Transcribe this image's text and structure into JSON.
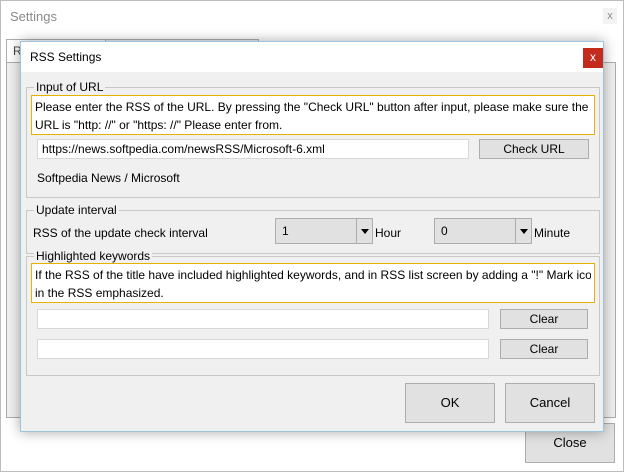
{
  "background": {
    "title": "Settings",
    "close_glyph": "x",
    "tab_a": "R",
    "tab_b": "",
    "close_button": "Close"
  },
  "dialog": {
    "title": "RSS Settings",
    "close_glyph": "x",
    "url_group": {
      "label": "Input of URL",
      "note_line1": "Please enter the RSS of the URL. By pressing the \"Check URL\" button after input, please make sure the URL",
      "note_line2": "URL is \"http: //\" or \"https: //\" Please enter from.",
      "url_value": "https://news.softpedia.com/newsRSS/Microsoft-6.xml",
      "check_button": "Check URL",
      "feed_title": "Softpedia News / Microsoft"
    },
    "interval_group": {
      "label": "Update interval",
      "row_label": "RSS of the update check interval",
      "hour_value": "1",
      "hour_unit": "Hour",
      "minute_value": "0",
      "minute_unit": "Minute"
    },
    "keywords_group": {
      "label": "Highlighted keywords",
      "note_line1": "If the RSS of the title have included highlighted keywords, and in RSS list screen by adding a \"!\" Mark icon",
      "note_line2": "in the RSS emphasized.",
      "keyword1_value": "",
      "keyword2_value": "",
      "clear_button_1": "Clear",
      "clear_button_2": "Clear"
    },
    "ok_button": "OK",
    "cancel_button": "Cancel"
  },
  "colors": {
    "note_border": "#e6b100",
    "close_red": "#c42b1c",
    "button_face": "#e1e1e1"
  }
}
